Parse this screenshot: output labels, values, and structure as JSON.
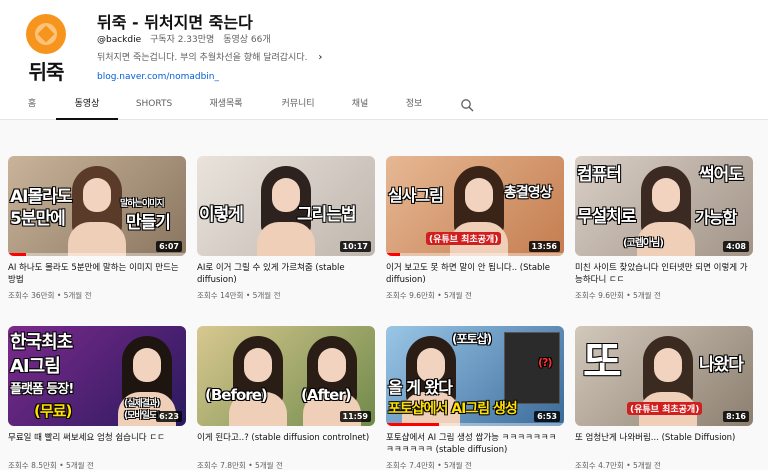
{
  "channel": {
    "logo_text": "뒤죽",
    "title": "뒤죽 - 뒤처지면 죽는다",
    "handle": "@backdie",
    "subscribers": "구독자 2.33만명",
    "video_count": "동영상 66개",
    "description": "뒤처지면 죽는겁니다. 부의 추월차선을 향해 달려갑시다.",
    "link": "blog.naver.com/nomadbin_"
  },
  "tabs": [
    {
      "label": "홈"
    },
    {
      "label": "동영상",
      "active": true
    },
    {
      "label": "SHORTS"
    },
    {
      "label": "재생목록"
    },
    {
      "label": "커뮤니티"
    },
    {
      "label": "채널"
    },
    {
      "label": "정보"
    }
  ],
  "videos": [
    {
      "title": "AI 하나도 몰라도 5분만에 말하는 이미지 만드는 방법",
      "views": "조회수 36만회",
      "age": "5개월 전",
      "duration": "6:07",
      "thumb_texts": [
        "AI몰라도",
        "5분만에",
        "말하는이미지",
        "만들기"
      ],
      "colors": {
        "bg1": "#8a7560",
        "bg2": "#c9b49a",
        "hair": "#5a3a28"
      },
      "progress": 0.1
    },
    {
      "title": "AI로 이거 그릴 수 있게 가르쳐줌 (stable diffusion)",
      "views": "조회수 14만회",
      "age": "5개월 전",
      "duration": "10:17",
      "thumb_texts": [
        "이렇게",
        "그리는법"
      ],
      "colors": {
        "bg1": "#bfb6ad",
        "bg2": "#e9e3dc",
        "hair": "#2d221d"
      },
      "progress": 0
    },
    {
      "title": "이거 보고도 못 하면 말이 안 됩니다.. (Stable diffusion)",
      "views": "조회수 9.6만회",
      "age": "5개월 전",
      "duration": "13:56",
      "thumb_texts": [
        "실사그림",
        "총결영상",
        "(유튜브 최초공개)"
      ],
      "colors": {
        "bg1": "#c47d4f",
        "bg2": "#e6b894",
        "hair": "#3a2417"
      },
      "progress": 0.08
    },
    {
      "title": "미친 사이트 찾았습니다 인터넷만 되면 이렇게 가능하다니 ㄷㄷ",
      "views": "조회수 9.6만회",
      "age": "5개월 전",
      "duration": "4:08",
      "thumb_texts": [
        "컴퓨터",
        "썩어도",
        "무설치로",
        "가능함",
        "(코렙아님)"
      ],
      "colors": {
        "bg1": "#a29488",
        "bg2": "#d9cfc6",
        "hair": "#3a2a22"
      },
      "progress": 0
    },
    {
      "title": "무료일 때 빨리 써보세요 엄청 쉽습니다 ㄷㄷ",
      "views": "조회수 8.5만회",
      "age": "5개월 전",
      "duration": "6:23",
      "thumb_texts": [
        "한국최초",
        "AI그림",
        "플랫폼 등장!",
        "(무료)",
        "(실제결과)",
        "(모바일도)"
      ],
      "colors": {
        "bg1": "#2a1a5e",
        "bg2": "#7b2a8c",
        "hair": "#1e1410"
      },
      "progress": 0
    },
    {
      "title": "이게 된다고..? (stable diffusion controlnet)",
      "views": "조회수 7.8만회",
      "age": "5개월 전",
      "duration": "11:59",
      "thumb_texts": [
        "(Before)",
        "(After)"
      ],
      "colors": {
        "bg1": "#6f8a4a",
        "bg2": "#d8c890",
        "hair": "#2a1d15"
      },
      "progress": 0
    },
    {
      "title": "포토샵에서 AI 그림 생성 쌉가능 ㅋㅋㅋㅋㅋㅋㅋㅋㅋㅋㅋㅋㅋ (stable diffusion)",
      "views": "조회수 7.4만회",
      "age": "5개월 전",
      "duration": "6:53",
      "thumb_texts": [
        "(포토샵)",
        "올 게 왔다",
        "포토샵에서 AI그림 생성",
        "(?)"
      ],
      "colors": {
        "bg1": "#3a6a9a",
        "bg2": "#9ac6e6",
        "hair": "#2a1d15"
      },
      "progress": 0.3
    },
    {
      "title": "또 엄청난게 나와버림... (Stable Diffusion)",
      "views": "조회수 4.7만회",
      "age": "5개월 전",
      "duration": "8:16",
      "thumb_texts": [
        "또",
        "나왔다",
        "(유튜브 최초공개)"
      ],
      "colors": {
        "bg1": "#8c7f70",
        "bg2": "#d2c8bb",
        "hair": "#3a2a20"
      },
      "progress": 0
    }
  ]
}
